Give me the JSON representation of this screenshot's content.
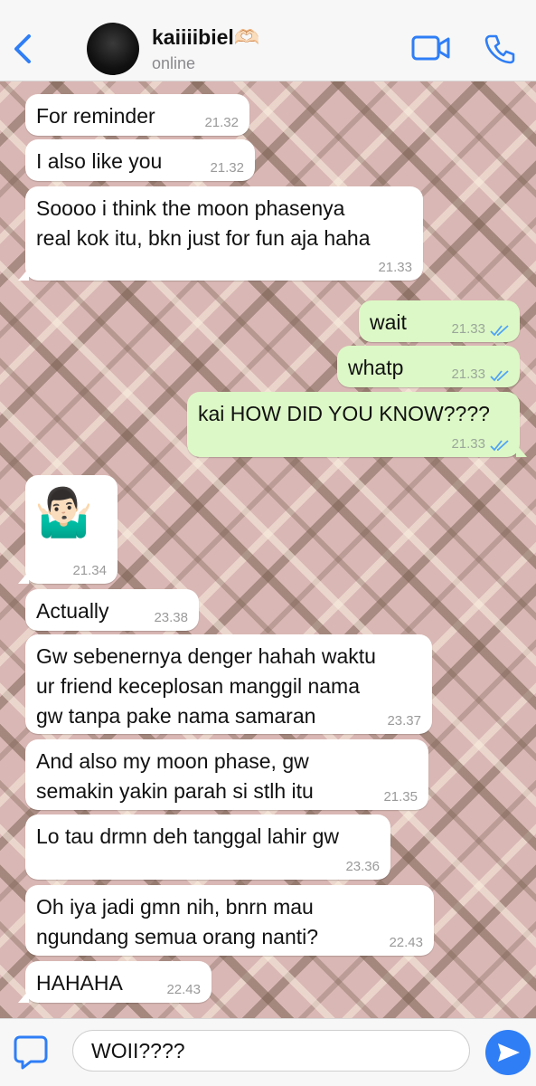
{
  "header": {
    "contact_name": "kaiiiibiel🫶🏻",
    "status": "online"
  },
  "messages": [
    {
      "text": "For reminder",
      "time": "21.32"
    },
    {
      "text": "I also like you",
      "time": "21.32"
    },
    {
      "line1": "Soooo i think the moon phasenya",
      "line2": "real kok itu, bkn just for fun aja haha",
      "time": "21.33"
    },
    {
      "text": "wait",
      "time": "21.33"
    },
    {
      "text": "whatp",
      "time": "21.33"
    },
    {
      "text": "kai HOW DID YOU KNOW????",
      "time": "21.33"
    },
    {
      "emoji": "🤷🏻‍♂️",
      "time": "21.34"
    },
    {
      "text": "Actually",
      "time": "23.38"
    },
    {
      "line1": "Gw sebenernya denger hahah waktu",
      "line2": "ur friend keceplosan manggil nama",
      "line3": "gw tanpa pake nama samaran",
      "time": "23.37"
    },
    {
      "line1": "And also my moon phase, gw",
      "line2": "semakin yakin parah si stlh itu",
      "time": "21.35"
    },
    {
      "text": "Lo tau drmn deh tanggal lahir gw",
      "time": "23.36"
    },
    {
      "line1": "Oh iya jadi gmn nih, bnrn mau",
      "line2": "ngundang semua orang nanti?",
      "time": "22.43"
    },
    {
      "text": "HAHAHA",
      "time": "22.43"
    }
  ],
  "composer": {
    "value": "WOII????"
  },
  "colors": {
    "outgoing_bubble": "#dcf8c6",
    "incoming_bubble": "#ffffff",
    "accent": "#2f7ef6",
    "read_ticks": "#4fa3f7"
  },
  "icons": [
    "back-chevron-icon",
    "video-call-icon",
    "phone-icon",
    "attach-icon",
    "send-icon",
    "read-receipt-icon"
  ]
}
